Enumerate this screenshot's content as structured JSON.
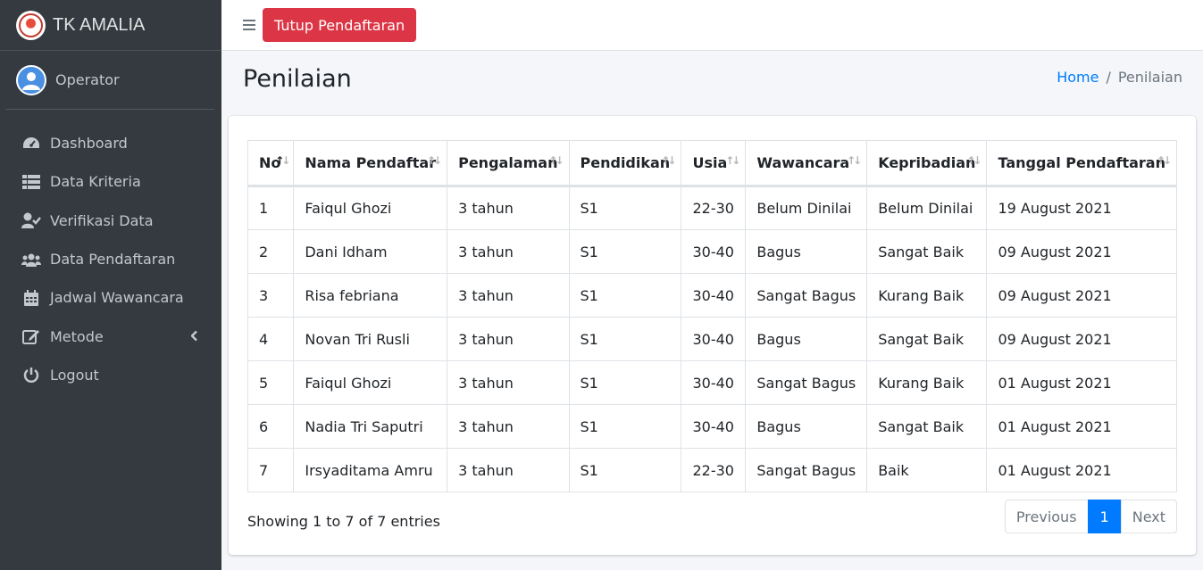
{
  "brand": {
    "name": "TK AMALIA",
    "logo_text": "AMALIA"
  },
  "user": {
    "name": "Operator"
  },
  "sidebar": {
    "items": [
      {
        "label": "Dashboard",
        "icon": "tachometer-icon"
      },
      {
        "label": "Data Kriteria",
        "icon": "list-icon"
      },
      {
        "label": "Verifikasi Data",
        "icon": "user-check-icon"
      },
      {
        "label": "Data Pendaftaran",
        "icon": "users-icon"
      },
      {
        "label": "Jadwal Wawancara",
        "icon": "calendar-icon"
      },
      {
        "label": "Metode",
        "icon": "edit-icon"
      },
      {
        "label": "Logout",
        "icon": "power-icon"
      }
    ]
  },
  "topbar": {
    "close_button": "Tutup Pendaftaran"
  },
  "page": {
    "title": "Penilaian"
  },
  "breadcrumb": {
    "home": "Home",
    "separator": "/",
    "current": "Penilaian"
  },
  "table": {
    "columns": [
      "No",
      "Nama Pendaftar",
      "Pengalaman",
      "Pendidikan",
      "Usia",
      "Wawancara",
      "Kepribadian",
      "Tanggal Pendaftaran"
    ],
    "rows": [
      [
        "1",
        "Faiqul Ghozi",
        "3 tahun",
        "S1",
        "22-30",
        "Belum Dinilai",
        "Belum Dinilai",
        "19 August 2021"
      ],
      [
        "2",
        "Dani Idham",
        "3 tahun",
        "S1",
        "30-40",
        "Bagus",
        "Sangat Baik",
        "09 August 2021"
      ],
      [
        "3",
        "Risa febriana",
        "3 tahun",
        "S1",
        "30-40",
        "Sangat Bagus",
        "Kurang Baik",
        "09 August 2021"
      ],
      [
        "4",
        "Novan Tri Rusli",
        "3 tahun",
        "S1",
        "30-40",
        "Bagus",
        "Sangat Baik",
        "09 August 2021"
      ],
      [
        "5",
        "Faiqul Ghozi",
        "3 tahun",
        "S1",
        "30-40",
        "Sangat Bagus",
        "Kurang Baik",
        "01 August 2021"
      ],
      [
        "6",
        "Nadia Tri Saputri",
        "3 tahun",
        "S1",
        "30-40",
        "Bagus",
        "Sangat Baik",
        "01 August 2021"
      ],
      [
        "7",
        "Irsyaditama Amru",
        "3 tahun",
        "S1",
        "22-30",
        "Sangat Bagus",
        "Baik",
        "01 August 2021"
      ]
    ],
    "info": "Showing 1 to 7 of 7 entries"
  },
  "pagination": {
    "previous": "Previous",
    "current": "1",
    "next": "Next"
  },
  "colors": {
    "sidebar_bg": "#343a40",
    "danger": "#dc3545",
    "primary": "#007bff"
  }
}
